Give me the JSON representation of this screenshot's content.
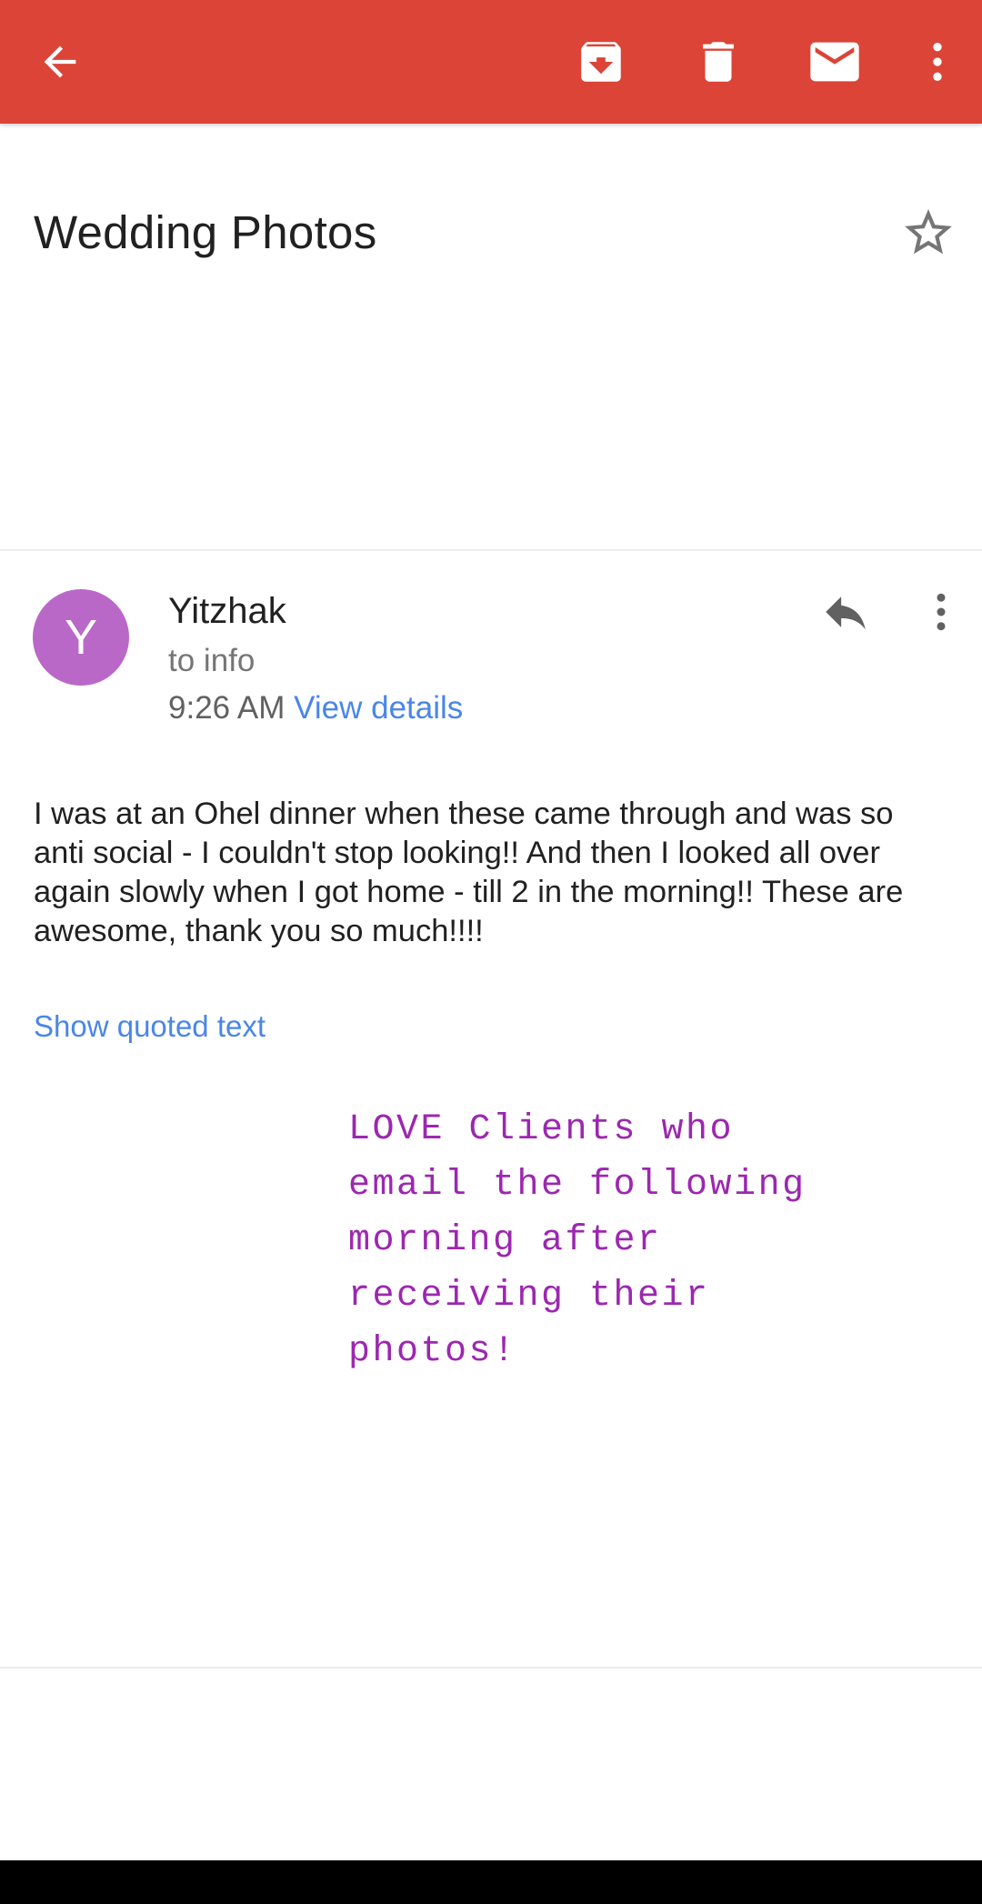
{
  "toolbar": {
    "back_icon": "arrow-left-icon",
    "archive_icon": "archive-icon",
    "delete_icon": "trash-icon",
    "mark_unread_icon": "mail-icon",
    "more_icon": "more-vert-icon",
    "bar_color": "#db4437"
  },
  "email": {
    "subject": "Wedding Photos",
    "star_icon": "star-outline-icon",
    "message": {
      "avatar_letter": "Y",
      "avatar_color": "#ba68c8",
      "sender": "Yitzhak",
      "recipient": "to info",
      "time": "9:26 AM",
      "details_link": "View details",
      "body": "I was at an Ohel dinner when these came through and was so anti social - I couldn't stop looking!! And then I looked all over again slowly when I got home - till 2 in the morning!! These are awesome, thank you so much!!!!",
      "show_quoted": "Show quoted text"
    }
  },
  "overlay_note": {
    "text": "LOVE Clients who\nemail the following\nmorning after\nreceiving their\nphotos!",
    "color": "#9c27b0"
  }
}
